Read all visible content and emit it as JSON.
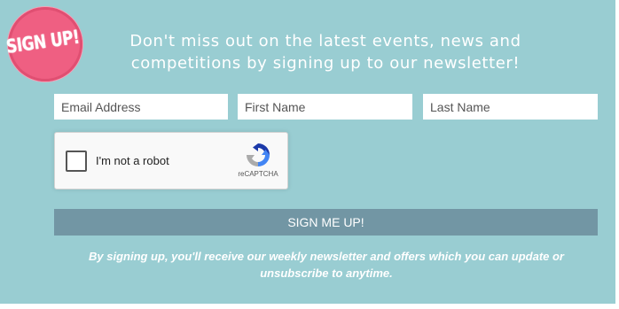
{
  "badge": {
    "text": "SIGN UP!",
    "color": "#ef5f82"
  },
  "headline": {
    "text": "Don't miss out on the latest events, news and competitions by signing up to our newsletter!"
  },
  "form": {
    "email_placeholder": "Email Address",
    "first_name_placeholder": "First Name",
    "last_name_placeholder": "Last Name",
    "email_value": "",
    "first_name_value": "",
    "last_name_value": ""
  },
  "captcha": {
    "label": "I'm not a robot",
    "brand": "reCAPTCHA",
    "checked": false,
    "logo_icon": "recaptcha-logo-icon"
  },
  "submit": {
    "label": "SIGN ME UP!",
    "color": "#7296a4"
  },
  "disclaimer": {
    "text": "By signing up, you'll receive our weekly newsletter and offers which you can update or unsubscribe to anytime."
  },
  "theme": {
    "background": "#99cdd2",
    "text": "#ffffff"
  }
}
